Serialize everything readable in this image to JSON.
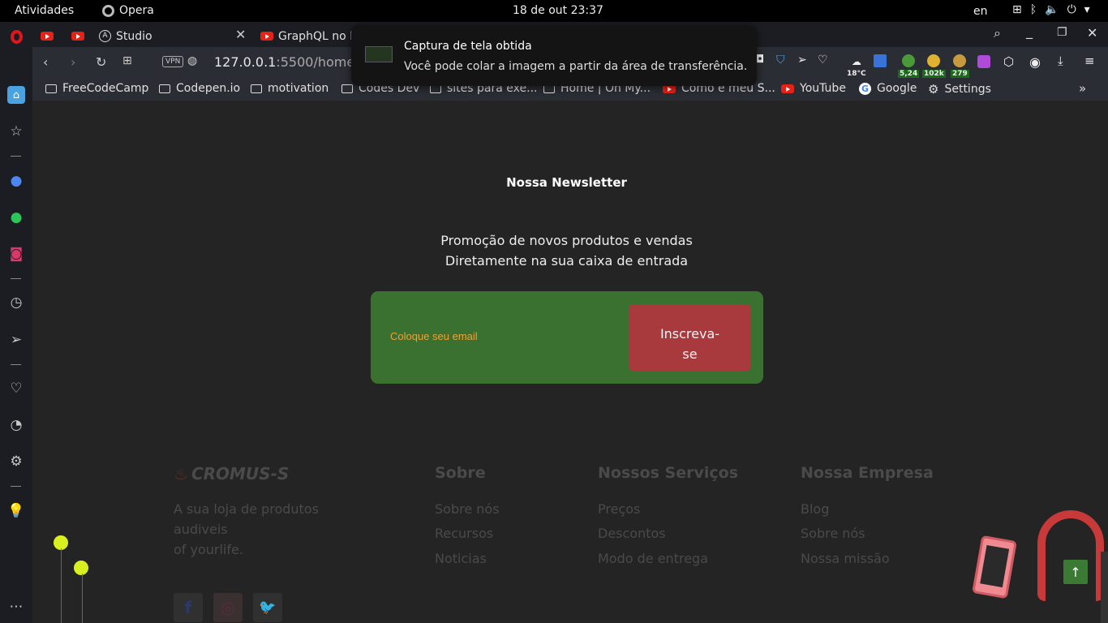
{
  "topbar": {
    "activities": "Atividades",
    "app": "Opera",
    "clock": "18 de out  23:37",
    "lang": "en"
  },
  "tabs": [
    {
      "label": ""
    },
    {
      "label": ""
    },
    {
      "label": "Studio"
    },
    {
      "label": "GraphQL no N"
    }
  ],
  "address": {
    "host": "127.0.0.1",
    "rest": ":5500/home.ht"
  },
  "extensions": {
    "weather": "18°C",
    "badge1": "5,24",
    "badge2": "102k",
    "badge3": "279"
  },
  "bookmarks": [
    {
      "label": "FreeCodeCamp"
    },
    {
      "label": "Codepen.io"
    },
    {
      "label": "motivation"
    },
    {
      "label": "Codes Dev"
    },
    {
      "label": "sites para exe..."
    },
    {
      "label": "Home | On My..."
    },
    {
      "label": "Como é meu S..."
    },
    {
      "label": "YouTube"
    },
    {
      "label": "Google"
    },
    {
      "label": "Settings"
    }
  ],
  "notification": {
    "title": "Captura de tela obtida",
    "body": "Você pode colar a imagem a partir da área de transferência."
  },
  "newsletter": {
    "title": "Nossa Newsletter",
    "line1": "Promoção de novos produtos e vendas",
    "line2": "Diretamente na sua caixa de entrada",
    "placeholder": "Coloque seu email",
    "button": "Inscreva-se",
    "button_line1": "Inscreva-",
    "button_line2": "se"
  },
  "footer": {
    "brand": "CROMUS-S",
    "tagline1": "A sua loja de produtos",
    "tagline2": "audiveis",
    "tagline3": "of yourlife.",
    "columns": [
      {
        "title": "Sobre",
        "items": [
          "Sobre nós",
          "Recursos",
          "Noticias"
        ]
      },
      {
        "title": "Nossos Serviços",
        "items": [
          "Preços",
          "Descontos",
          "Modo de entrega"
        ]
      },
      {
        "title": "Nossa Empresa",
        "items": [
          "Blog",
          "Sobre nós",
          "Nossa missão"
        ]
      }
    ],
    "social": {
      "facebook": "f",
      "instagram": "◎",
      "twitter": "🐦"
    }
  },
  "colors": {
    "form_bg": "#3a7030",
    "button_bg": "#a83a3e",
    "placeholder": "#f0a038",
    "page_bg": "#242424"
  }
}
